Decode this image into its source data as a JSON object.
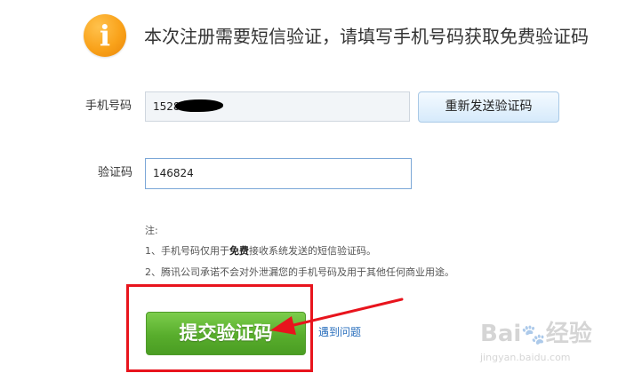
{
  "header": {
    "icon_glyph": "i",
    "icon_name": "info-icon",
    "title": "本次注册需要短信验证，请填写手机号码获取免费验证码"
  },
  "form": {
    "phone": {
      "label": "手机号码",
      "value": "1528"
    },
    "resend_button_label": "重新发送验证码",
    "code": {
      "label": "验证码",
      "value": "146824"
    }
  },
  "notes": {
    "title": "注:",
    "line1_prefix": "1、手机号码仅用于",
    "line1_bold": "免费",
    "line1_suffix": "接收系统发送的短信验证码。",
    "line2": "2、腾讯公司承诺不会对外泄漏您的手机号码及用于其他任何商业用途。"
  },
  "actions": {
    "submit_label": "提交验证码",
    "help_link": "遇到问题"
  },
  "watermark": {
    "brand": "Bai",
    "brand_tail": "经验",
    "url": "jingyan.baidu.com"
  },
  "colors": {
    "accent_orange": "#f9a21a",
    "submit_green": "#58ad2c",
    "annotation_red": "#e8141d",
    "link_blue": "#2a6fbd"
  }
}
